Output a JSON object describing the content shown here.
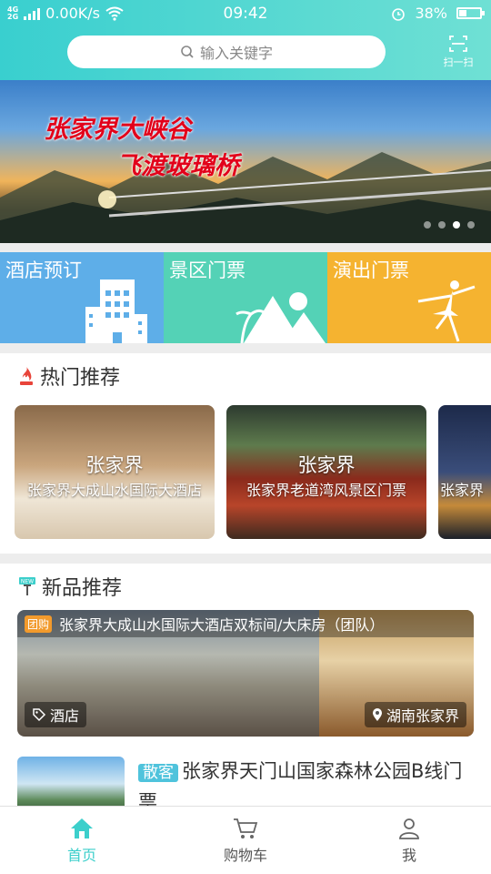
{
  "status_bar": {
    "network": "4G/2G",
    "speed": "0.00K/s",
    "time": "09:42",
    "battery": "38%",
    "battery_level": 0.38
  },
  "header": {
    "search_placeholder": "输入关键字",
    "scan_label": "扫一扫"
  },
  "banner": {
    "line1": "张家界大峡谷",
    "line2": "飞渡玻璃桥",
    "slides": 4,
    "active_slide": 3
  },
  "categories": [
    {
      "label": "酒店预订",
      "icon": "hotel-building-icon",
      "color": "#5eaee8"
    },
    {
      "label": "景区门票",
      "icon": "mountain-icon",
      "color": "#54d2b6"
    },
    {
      "label": "演出门票",
      "icon": "dancer-icon",
      "color": "#f5b330"
    }
  ],
  "hot": {
    "title": "热门推荐",
    "icon": "flame-icon",
    "cards": [
      {
        "name": "张家界",
        "sub": "张家界大成山水国际大酒店"
      },
      {
        "name": "张家界",
        "sub": "张家界老道湾风景区门票"
      },
      {
        "name": "",
        "sub": "张家界"
      }
    ]
  },
  "new": {
    "title": "新品推荐",
    "icon": "new-badge-icon",
    "featured": {
      "tag": "团购",
      "title": "张家界大成山水国际大酒店双标间/大床房（团队）",
      "category": "酒店",
      "location": "湖南张家界"
    },
    "item": {
      "tag": "散客",
      "title": "张家界天门山国家森林公园B线门票"
    }
  },
  "nav": [
    {
      "label": "首页",
      "icon": "home-icon",
      "active": true
    },
    {
      "label": "购物车",
      "icon": "cart-icon",
      "active": false
    },
    {
      "label": "我",
      "icon": "user-icon",
      "active": false
    }
  ],
  "colors": {
    "accent": "#3ccfcb",
    "header": "#4fd6d2"
  }
}
